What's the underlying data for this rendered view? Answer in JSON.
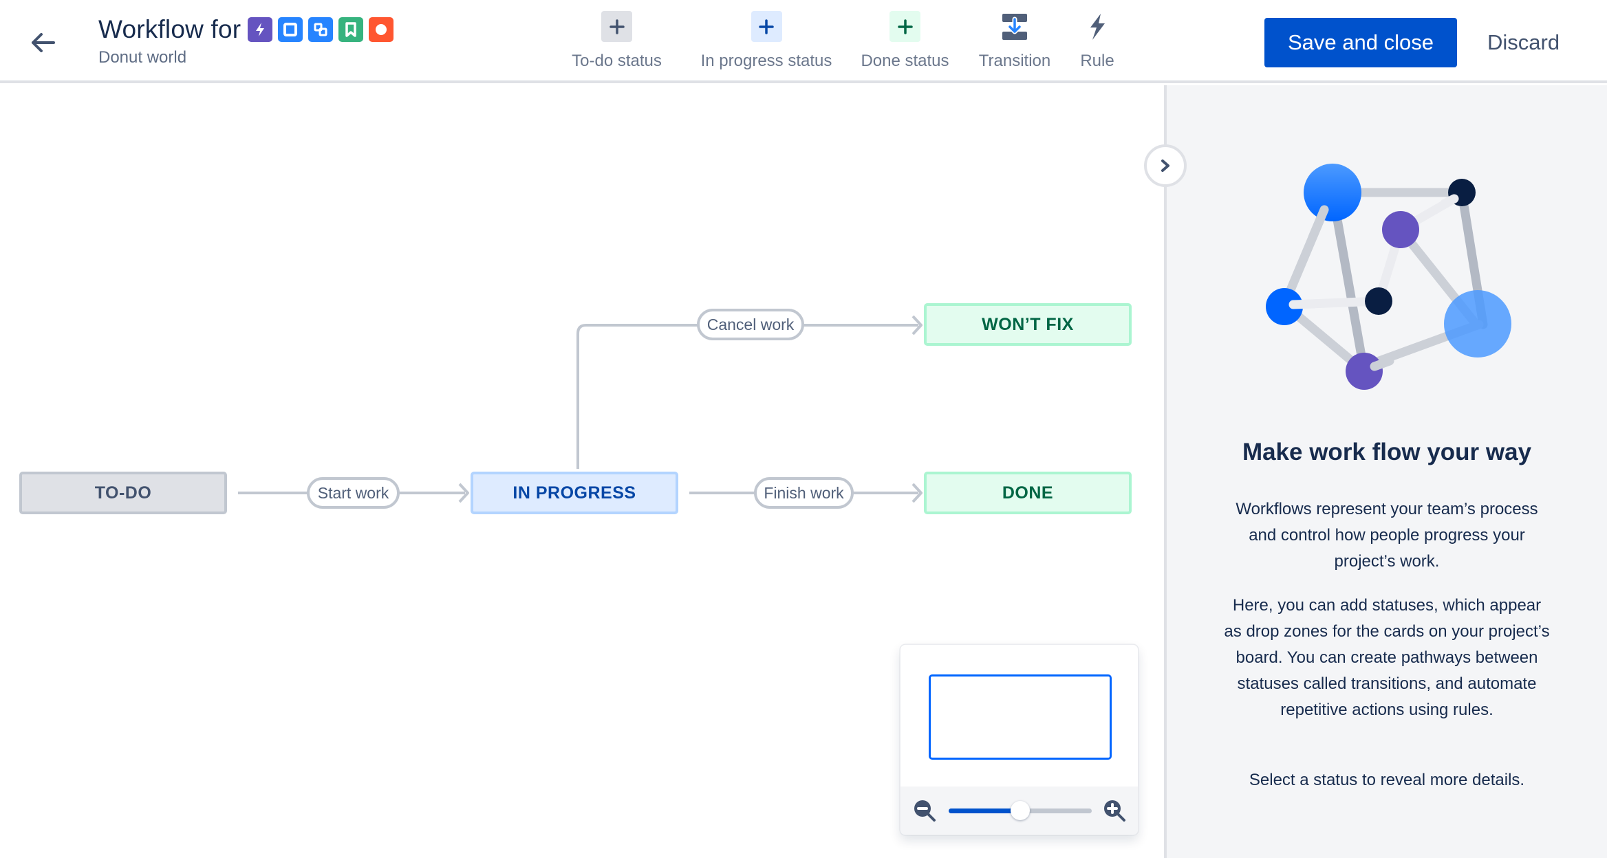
{
  "header": {
    "back_label": "Back",
    "title": "Workflow for",
    "subtitle": "Donut world",
    "issue_types": [
      {
        "name": "epic",
        "icon": "lightning-icon",
        "color": "#6554c0"
      },
      {
        "name": "task",
        "icon": "square-icon",
        "color": "#2684ff"
      },
      {
        "name": "subtask",
        "icon": "subtask-icon",
        "color": "#2684ff"
      },
      {
        "name": "story",
        "icon": "bookmark-icon",
        "color": "#36b37e"
      },
      {
        "name": "bug",
        "icon": "circle-icon",
        "color": "#ff5630"
      }
    ]
  },
  "toolbar": {
    "items": [
      {
        "label": "To-do status",
        "icon": "plus-icon"
      },
      {
        "label": "In progress status",
        "icon": "plus-icon"
      },
      {
        "label": "Done status",
        "icon": "plus-icon"
      },
      {
        "label": "Transition",
        "icon": "transition-icon"
      },
      {
        "label": "Rule",
        "icon": "lightning-icon"
      }
    ],
    "save_label": "Save and close",
    "discard_label": "Discard"
  },
  "workflow": {
    "statuses": [
      {
        "id": "todo",
        "label": "TO-DO",
        "category": "todo"
      },
      {
        "id": "inprogress",
        "label": "IN PROGRESS",
        "category": "inprogress"
      },
      {
        "id": "wontfix",
        "label": "WON’T FIX",
        "category": "done"
      },
      {
        "id": "done",
        "label": "DONE",
        "category": "done"
      }
    ],
    "transitions": [
      {
        "label": "Start work",
        "from": "todo",
        "to": "inprogress"
      },
      {
        "label": "Cancel work",
        "from": "inprogress",
        "to": "wontfix"
      },
      {
        "label": "Finish work",
        "from": "inprogress",
        "to": "done"
      }
    ]
  },
  "minimap": {
    "zoom_out_label": "Zoom out",
    "zoom_in_label": "Zoom in",
    "zoom_level_fraction": 0.5
  },
  "panel": {
    "collapse_label": "Collapse panel",
    "title": "Make work flow your way",
    "paragraphs": [
      "Workflows represent your team’s process and control how people progress your project’s work.",
      "Here, you can add statuses, which appear as drop zones for the cards on your project’s board. You can create pathways between statuses called transitions, and automate repetitive actions using rules.",
      "Select a status to reveal more details."
    ]
  },
  "colors": {
    "primary": "#0052cc",
    "edge": "#c1c7d0",
    "todo_bg": "#dfe1e6",
    "inprogress_bg": "#deebff",
    "done_bg": "#e3fcef"
  }
}
